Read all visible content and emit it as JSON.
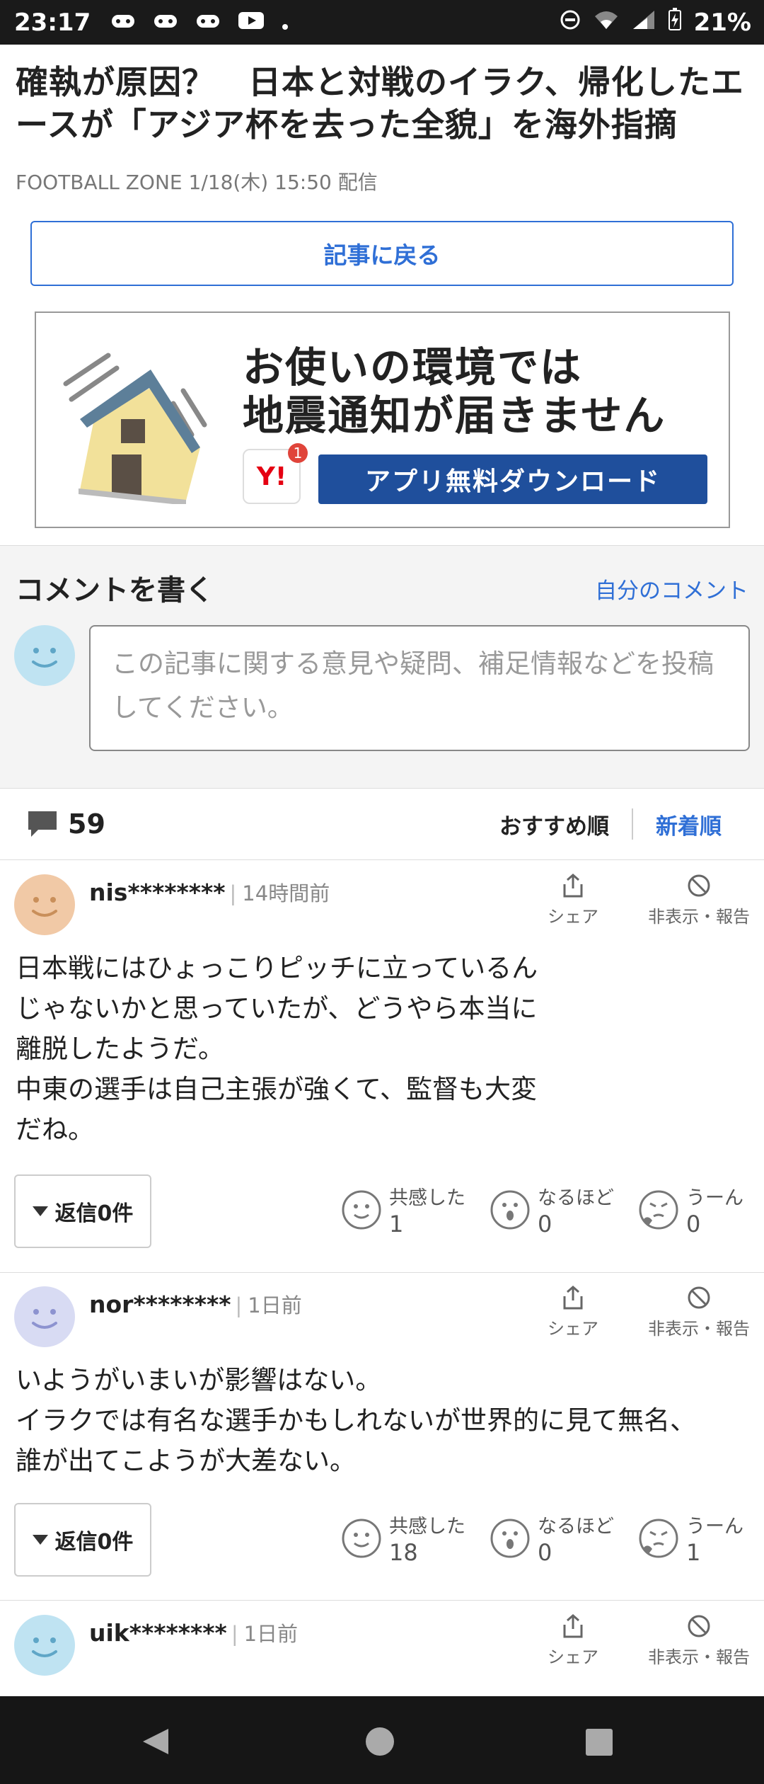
{
  "status_bar": {
    "time": "23:17",
    "battery": "21%"
  },
  "article": {
    "title": "確執が原因？　日本と対戦のイラク、帰化したエースが「アジア杯を去った全貌」を海外指摘",
    "meta": "FOOTBALL ZONE 1/18(木) 15:50 配信",
    "back_label": "記事に戻る"
  },
  "ad": {
    "line1": "お使いの環境では",
    "line2": "地震通知が届きません",
    "logo_text": "Y!",
    "badge": "1",
    "download_label": "アプリ無料ダウンロード"
  },
  "comment_form": {
    "title": "コメントを書く",
    "my_comments_link": "自分のコメント",
    "placeholder": "この記事に関する意見や疑問、補足情報などを投稿してください。"
  },
  "comments_header": {
    "count": "59",
    "sort_recommended": "おすすめ順",
    "sort_newest": "新着順"
  },
  "labels": {
    "share": "シェア",
    "hide_report": "非表示・報告",
    "empathy": "共感した",
    "naruhodo": "なるほど",
    "uun": "うーん"
  },
  "comments": [
    {
      "user": "nis********",
      "time": "14時間前",
      "body": "日本戦にはひょっこりピッチに立っているん\nじゃないかと思っていたが、どうやら本当に\n離脱したようだ。\n中東の選手は自己主張が強くて、監督も大変\nだね。",
      "reply_label": "返信0件",
      "empathy": "1",
      "naruhodo": "0",
      "uun": "0",
      "avatar_color": "#f1c9a6"
    },
    {
      "user": "nor********",
      "time": "1日前",
      "body": "いようがいまいが影響はない。\nイラクでは有名な選手かもしれないが世界的に見て無名、\n誰が出てこようが大差ない。",
      "reply_label": "返信0件",
      "empathy": "18",
      "naruhodo": "0",
      "uun": "1",
      "avatar_color": "#d8dbf3"
    },
    {
      "user": "uik********",
      "time": "1日前",
      "avatar_color": "#bfe3f2"
    }
  ]
}
